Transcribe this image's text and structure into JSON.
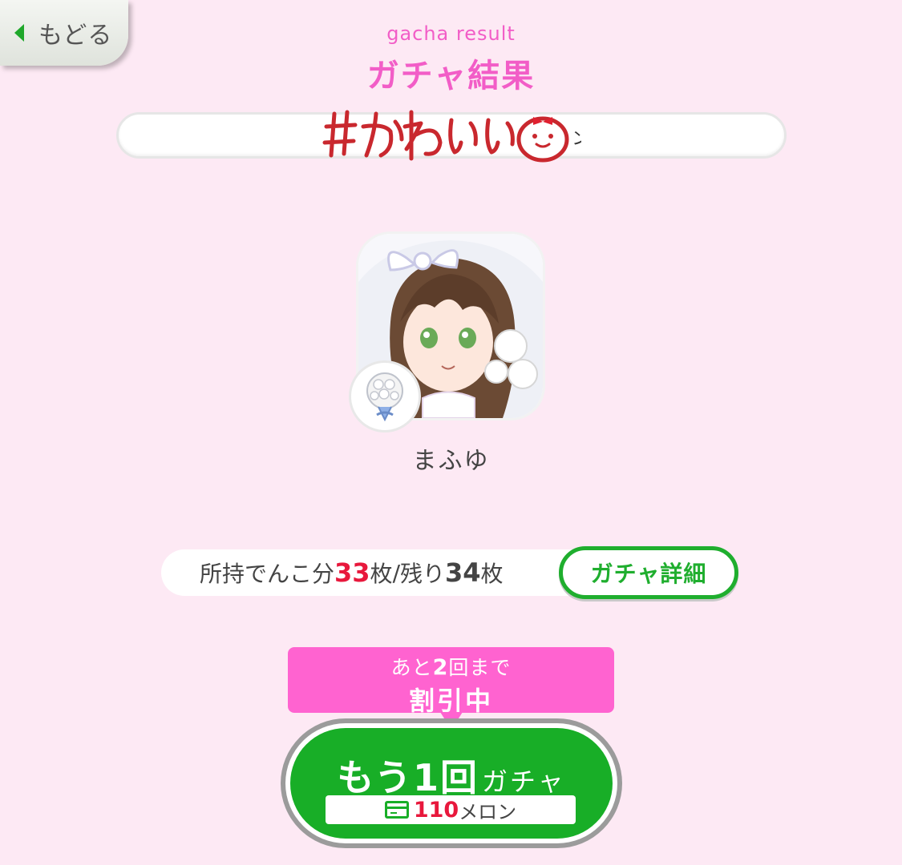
{
  "header": {
    "back_label": "もどる",
    "subtitle": "gacha result",
    "title": "ガチャ結果"
  },
  "gacha": {
    "logo_text": "#かわいいン",
    "logo_color": "#c9282e"
  },
  "result": {
    "character_name": "まふゆ",
    "item_icon": "bouquet-icon"
  },
  "coins": {
    "owned_prefix": "所持でんこ分",
    "owned_count": "33",
    "owned_unit": "枚",
    "separator": "/",
    "remaining_prefix": "残り",
    "remaining_count": "34",
    "remaining_unit": "枚",
    "detail_button": "ガチャ詳細"
  },
  "discount": {
    "line1_prefix": "あと",
    "line1_count": "2",
    "line1_suffix": "回まで",
    "line2": "割引中"
  },
  "again_button": {
    "big_label": "もう1回",
    "small_label": "ガチャ",
    "price": "110",
    "currency": "メロン",
    "currency_icon": "card-icon"
  },
  "colors": {
    "background": "#fde9f4",
    "accent_pink": "#f25dc7",
    "green": "#18ae27",
    "red": "#e8183c"
  }
}
